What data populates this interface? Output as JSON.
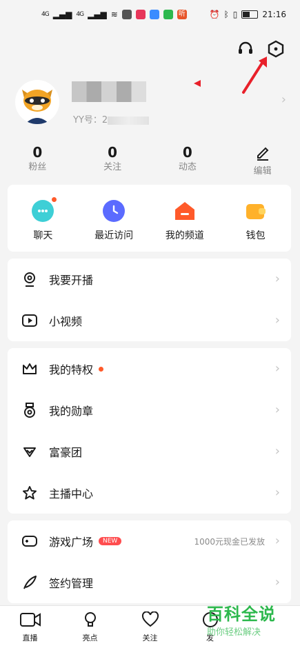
{
  "status": {
    "signal1": "4G",
    "signal2": "4G",
    "battery": "",
    "time": "21:16",
    "app_tags": [
      "",
      "",
      "听"
    ]
  },
  "profile": {
    "yy_label": "YY号：",
    "yy_prefix": "2"
  },
  "stats": [
    {
      "num": "0",
      "label": "粉丝"
    },
    {
      "num": "0",
      "label": "关注"
    },
    {
      "num": "0",
      "label": "动态"
    },
    {
      "num": "",
      "label": "编辑"
    }
  ],
  "quick": [
    {
      "label": "聊天",
      "color": "#3ecfd6"
    },
    {
      "label": "最近访问",
      "color": "#5b6bff"
    },
    {
      "label": "我的频道",
      "color": "#ff5a2a"
    },
    {
      "label": "钱包",
      "color": "#ffb12a"
    }
  ],
  "group1": [
    {
      "label": "我要开播",
      "icon": "webcam-icon"
    },
    {
      "label": "小视频",
      "icon": "play-icon"
    }
  ],
  "group2": [
    {
      "label": "我的特权",
      "icon": "crown-icon"
    },
    {
      "label": "我的勋章",
      "icon": "medal-icon"
    },
    {
      "label": "富豪团",
      "icon": "diamond-icon"
    },
    {
      "label": "主播中心",
      "icon": "star-icon"
    }
  ],
  "group3": [
    {
      "label": "游戏广场",
      "icon": "gamepad-icon",
      "badge": "NEW",
      "extra": "1000元现金已发放"
    },
    {
      "label": "签约管理",
      "icon": "feather-icon"
    }
  ],
  "tabs": [
    {
      "label": "直播",
      "icon": "camera-icon"
    },
    {
      "label": "亮点",
      "icon": "bulb-icon"
    },
    {
      "label": "关注",
      "icon": "heart-icon"
    },
    {
      "label": "发",
      "icon": "post-icon"
    }
  ],
  "watermark": {
    "title": "百科全说",
    "subtitle": "助你轻松解决"
  }
}
